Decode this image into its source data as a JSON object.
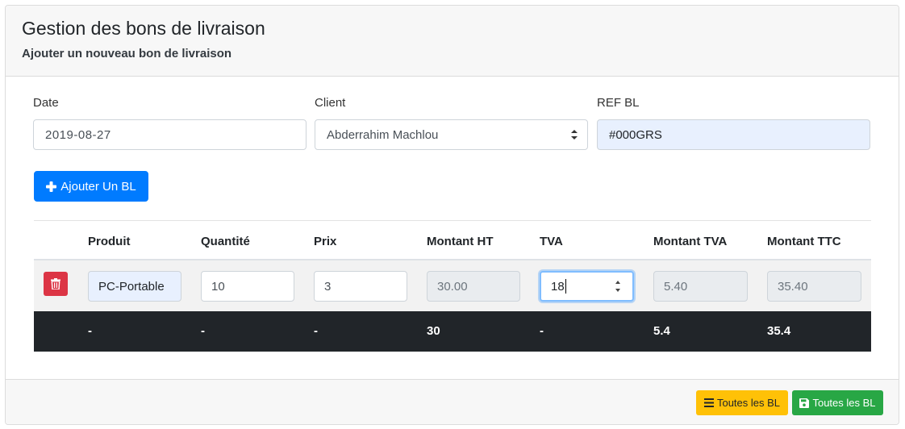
{
  "header": {
    "title": "Gestion des bons de livraison",
    "subtitle": "Ajouter un nouveau bon de livraison"
  },
  "form": {
    "date": {
      "label": "Date",
      "value": "2019-08-27"
    },
    "client": {
      "label": "Client",
      "value": "Abderrahim Machlou"
    },
    "ref": {
      "label": "REF BL",
      "value": "#000GRS"
    }
  },
  "add_button": {
    "label": "Ajouter Un BL",
    "icon": "plus-icon"
  },
  "table": {
    "headers": [
      "Produit",
      "Quantité",
      "Prix",
      "Montant HT",
      "TVA",
      "Montant TVA",
      "Montant TTC"
    ],
    "row": {
      "produit": "PC-Portable",
      "quantite": "10",
      "prix": "3",
      "montant_ht": "30.00",
      "tva": "18",
      "montant_tva": "5.40",
      "montant_ttc": "35.40"
    },
    "totals": [
      "-",
      "-",
      "-",
      "30",
      "-",
      "5.4",
      "35.4"
    ]
  },
  "footer": {
    "list_button": {
      "label": "Toutes les BL",
      "icon": "bars-icon",
      "color": "#ffc107"
    },
    "save_button": {
      "label": "Toutes les BL",
      "icon": "save-icon",
      "color": "#28a745"
    }
  },
  "colors": {
    "primary": "#007bff",
    "danger": "#dc3545",
    "dark": "#212529",
    "autofill": "#e8f0fe"
  }
}
